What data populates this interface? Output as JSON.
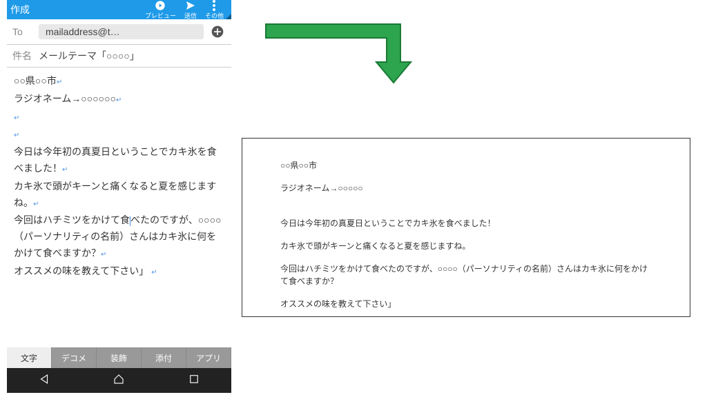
{
  "header": {
    "title": "作成",
    "preview_label": "プレビュー",
    "send_label": "送信",
    "other_label": "その他"
  },
  "to": {
    "label": "To",
    "value": "mailaddress@t…"
  },
  "subject": {
    "label": "件名",
    "value": "メールテーマ「○○○○」"
  },
  "body": {
    "line1": "○○県○○市",
    "line2": "ラジオネーム→○○○○○○",
    "line3": "今日は今年初の真夏日ということでカキ氷を食べました！",
    "line4": "カキ氷で頭がキーンと痛くなると夏を感じますね。",
    "line5": "今回はハチミツをかけて食べたのですが、○○○○（パーソナリティの名前）さんはカキ氷に何をかけて食べますか？",
    "line6": "オススメの味を教えて下さい」"
  },
  "tabs": {
    "text": "文字",
    "deco": "デコメ",
    "style": "装飾",
    "attach": "添付",
    "app": "アプリ"
  },
  "output": {
    "line1": "○○県○○市",
    "line2": "ラジオネーム→○○○○○",
    "line3": "今日は今年初の真夏日ということでカキ氷を食べました！",
    "line4": "カキ氷で頭がキーンと痛くなると夏を感じますね。",
    "line5": "今回はハチミツをかけて食べたのですが、○○○○（パーソナリティの名前）さんはカキ氷に何をかけて食べますか？",
    "line6": "オススメの味を教えて下さい」"
  }
}
